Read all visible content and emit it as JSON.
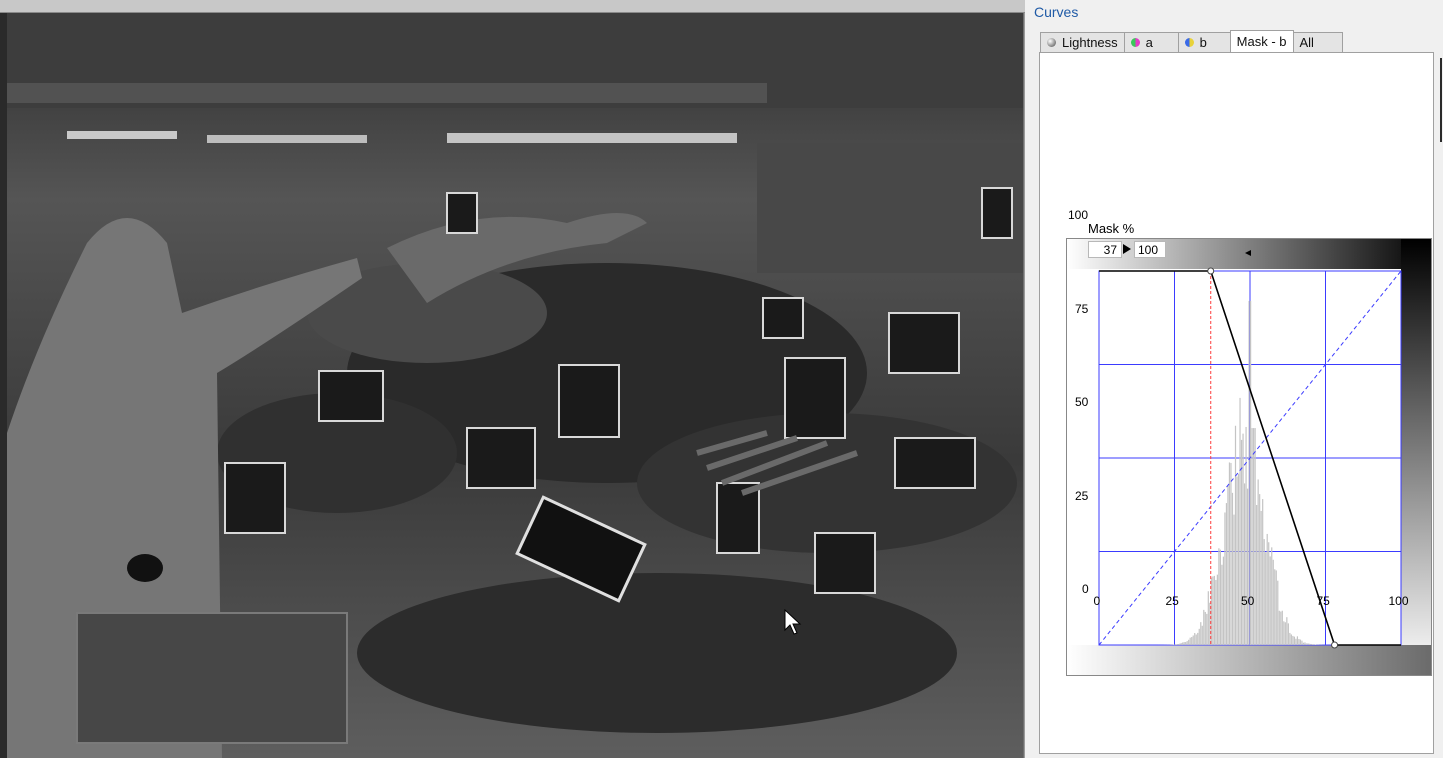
{
  "panel": {
    "title": "Curves",
    "tabs": [
      {
        "label": "Lightness",
        "icon": "lightness-channel-icon",
        "active": false
      },
      {
        "label": "a",
        "icon": "a-channel-icon",
        "active": false
      },
      {
        "label": "b",
        "icon": "b-channel-icon",
        "active": false
      },
      {
        "label": "Mask - b",
        "icon": "",
        "active": true
      },
      {
        "label": "All",
        "icon": "",
        "active": false
      }
    ]
  },
  "curve": {
    "readout_label": "Mask %",
    "input_value": "37",
    "output_value": "100",
    "x_ticks": [
      "0",
      "25",
      "50",
      "75",
      "100"
    ],
    "y_ticks": [
      "100",
      "75",
      "50",
      "25",
      "0"
    ],
    "points": [
      [
        0,
        100
      ],
      [
        37,
        100
      ],
      [
        78,
        0
      ],
      [
        100,
        0
      ]
    ],
    "grid_color": "#3b3bff",
    "curve_color": "#000000",
    "marker_color": "#ff3b3b"
  }
}
